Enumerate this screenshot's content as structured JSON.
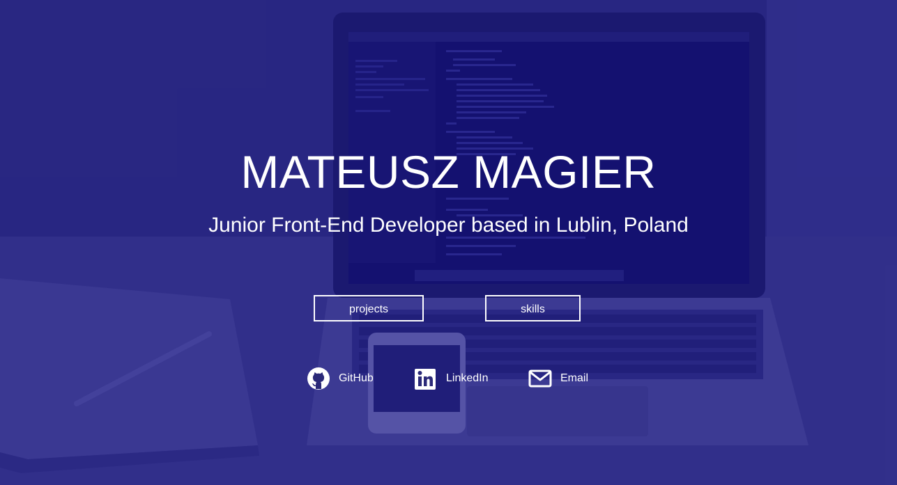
{
  "hero": {
    "name": "MATEUSZ MAGIER",
    "subtitle": "Junior Front-End Developer based in Lublin, Poland"
  },
  "buttons": {
    "projects": "projects",
    "skills": "skills"
  },
  "social": {
    "github": "GitHub",
    "linkedin": "LinkedIn",
    "email": "Email"
  },
  "icons": {
    "github": "github-icon",
    "linkedin": "linkedin-icon",
    "email": "envelope-icon"
  },
  "colors": {
    "overlay": "#1c1a7a",
    "text": "#ffffff"
  }
}
